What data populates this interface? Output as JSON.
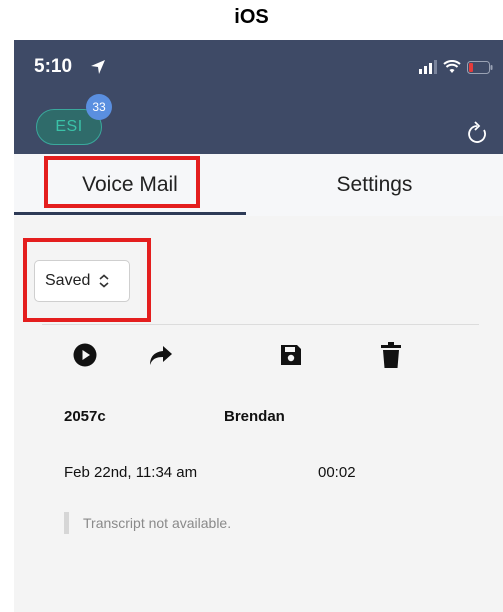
{
  "caption": "iOS",
  "status_bar": {
    "time": "5:10",
    "location_icon": "location-arrow-icon",
    "signal_icon": "signal-icon",
    "wifi_icon": "wifi-icon",
    "battery_icon": "battery-low-icon"
  },
  "header": {
    "badge_label": "ESI",
    "badge_count": "33",
    "refresh_icon": "refresh-icon"
  },
  "tabs": [
    {
      "label": "Voice Mail",
      "active": true
    },
    {
      "label": "Settings",
      "active": false
    }
  ],
  "filter": {
    "selected": "Saved"
  },
  "actions": [
    {
      "name": "play",
      "icon": "play-circle-icon"
    },
    {
      "name": "forward",
      "icon": "forward-arrow-icon"
    },
    {
      "name": "save",
      "icon": "floppy-disk-icon"
    },
    {
      "name": "delete",
      "icon": "trash-icon"
    }
  ],
  "message": {
    "extension": "2057c",
    "caller": "Brendan",
    "date": "Feb 22nd, 11:34 am",
    "duration": "00:02",
    "transcript": "Transcript not available."
  },
  "colors": {
    "header_bg": "#3e4a66",
    "highlight": "#e41e1e",
    "badge_count_bg": "#5a8fe0",
    "esi_text": "#3ac2a8"
  }
}
